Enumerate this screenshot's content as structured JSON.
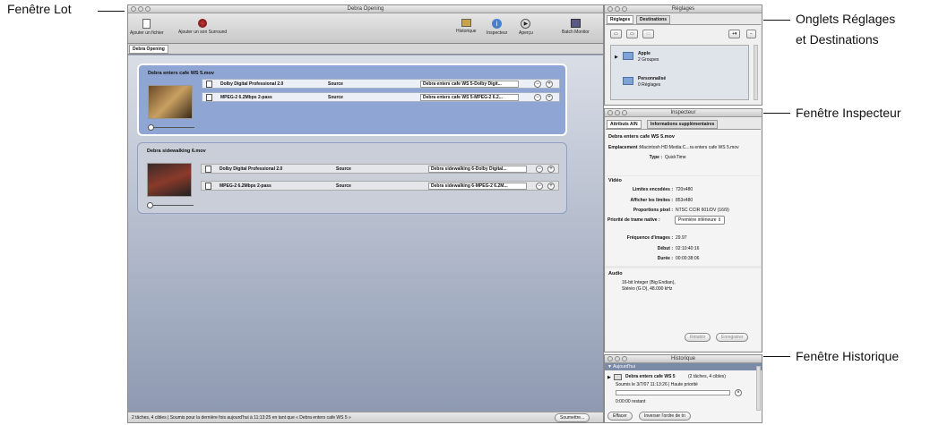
{
  "callouts": {
    "lot": "Fenêtre Lot",
    "tabs_l1": "Onglets Réglages",
    "tabs_l2": "et Destinations",
    "inspector": "Fenêtre Inspecteur",
    "history": "Fenêtre Historique"
  },
  "batch": {
    "title": "Debra Opening",
    "toolbar": {
      "add_file": "Ajouter un fichier",
      "add_surround": "Ajouter un son Surround",
      "history": "Historique",
      "inspector": "Inspecteur",
      "preview": "Aperçu",
      "batch_monitor": "Batch Monitor"
    },
    "tab": "Debra Opening",
    "jobs": [
      {
        "name": "Debra enters cafe WS 5.mov",
        "rows": [
          {
            "setting": "Dolby Digital Professional 2.0",
            "dest": "Source",
            "output": "Debra enters cafe WS 5-Dolby Digit..."
          },
          {
            "setting": "MPEG-2 6.2Mbps 2-pass",
            "dest": "Source",
            "output": "Debra enters cafe WS 5-MPEG-2 6.2..."
          }
        ]
      },
      {
        "name": "Debra sidewalking 6.mov",
        "rows": [
          {
            "setting": "Dolby Digital Professional 2.0",
            "dest": "Source",
            "output": "Debra sidewalking 6-Dolby Digital..."
          },
          {
            "setting": "MPEG-2 6.2Mbps 2-pass",
            "dest": "Source",
            "output": "Debra sidewalking 6-MPEG-2 6.2M..."
          }
        ]
      }
    ],
    "status": "2 tâches, 4 cibles  |  Soumis pour la dernière fois aujourd'hui à 11:13:25 en tant que « Debra enters cafe WS 5 »",
    "submit": "Soumettre..."
  },
  "settings": {
    "title": "Réglages",
    "tabs": [
      "Réglages",
      "Destinations"
    ],
    "groups": [
      {
        "name": "Apple",
        "sub": "2 Groupes"
      },
      {
        "name": "Personnalisé",
        "sub": "0 Réglages"
      }
    ]
  },
  "inspector": {
    "title": "Inspecteur",
    "tabs": [
      "Attributs A/N",
      "Informations supplémentaires"
    ],
    "file": "Debra enters cafe WS 5.mov",
    "location_label": "Emplacement :",
    "location": "Macintosh HD:Media:C...ra enters cafe WS 5.mov",
    "type_label": "Type :",
    "type": "QuickTime",
    "video": "Vidéo",
    "enc_label": "Limites encodées :",
    "enc": "720x480",
    "disp_label": "Afficher les limites :",
    "disp": "853x480",
    "pix_label": "Proportions pixel :",
    "pix": "NTSC CCIR 601/DV (16/9)",
    "field_label": "Priorité de trame native :",
    "field": "Première inférieure",
    "fps_label": "Fréquence d'images :",
    "fps": "29.97",
    "start_label": "Début :",
    "start": "02:10:40:16",
    "dur_label": "Durée :",
    "dur": "00:00:38:06",
    "audio": "Audio",
    "audio1": "16-bit Integer (Big Endian),",
    "audio2": "Stéréo (G D), 48.000 kHz",
    "revert": "Rétablir",
    "save": "Enregistrer"
  },
  "history": {
    "title": "Historique",
    "today": "Aujourd'hui",
    "job": "Debra enters cafe WS 5",
    "job_meta": "(2 tâches, 4 cibles)",
    "submitted": "Soumis le 3/7/07 11:13:26  |  Haute priorité",
    "remaining": "0:00:00 restant",
    "clear": "Effacer",
    "reverse": "Inverser l'ordre de tri"
  }
}
